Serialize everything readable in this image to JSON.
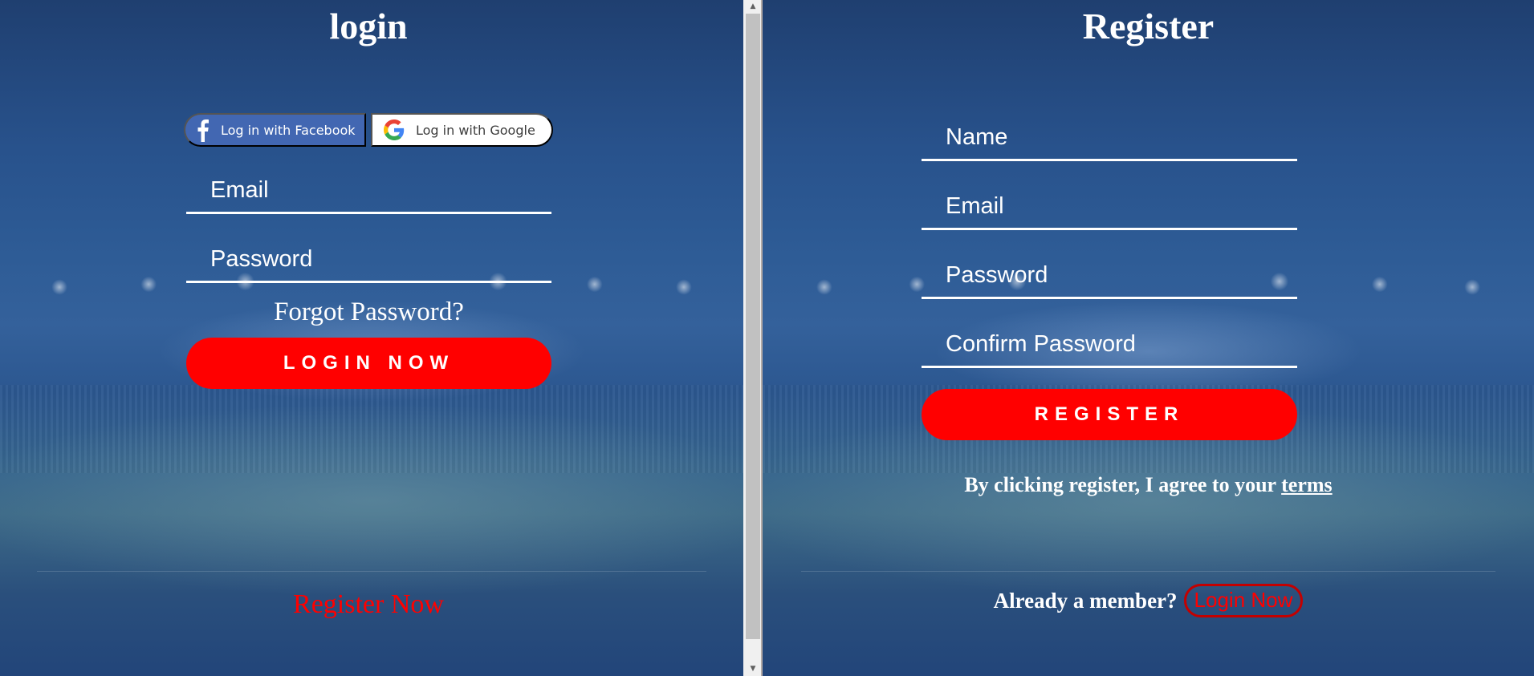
{
  "login": {
    "title": "login",
    "facebook_label": "Log in with Facebook",
    "google_label": "Log in with Google",
    "email_placeholder": "Email",
    "password_placeholder": "Password",
    "forgot_label": "Forgot Password?",
    "submit_label": "LOGIN NOW",
    "register_link_label": "Register Now"
  },
  "register": {
    "title": "Register",
    "name_placeholder": "Name",
    "email_placeholder": "Email",
    "password_placeholder": "Password",
    "confirm_placeholder": "Confirm Password",
    "submit_label": "REGISTER",
    "terms_prefix": "By clicking register, I agree to your",
    "terms_link": "terms",
    "member_text": "Already a member?",
    "login_link_label": "Login Now"
  },
  "colors": {
    "accent": "#ff0000",
    "facebook": "#4267b2",
    "background": "#2a5590"
  },
  "icons": {
    "facebook": "facebook-icon",
    "google": "google-icon"
  }
}
